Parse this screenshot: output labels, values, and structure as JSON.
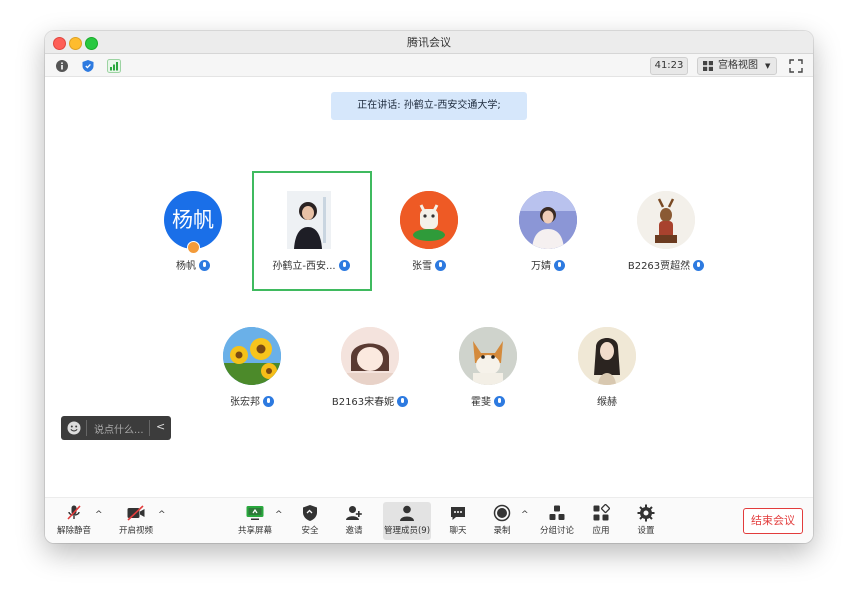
{
  "window": {
    "title": "腾讯会议"
  },
  "toolbar_top": {
    "info_icon": "info-icon",
    "security_icon": "shield-icon",
    "signal_icon": "signal-bars-icon",
    "timer": "41:23",
    "view_label": "宫格视图",
    "fullscreen_icon": "fullscreen-icon"
  },
  "speaker_banner": "正在讲话: 孙鹤立-西安交通大学;",
  "participants": [
    {
      "name": "杨帆",
      "avatar_text": "杨帆",
      "avatar_color": "#1a6fe8"
    },
    {
      "name": "孙鹤立-西安...",
      "active": true
    },
    {
      "name": "张雪"
    },
    {
      "name": "万婧"
    },
    {
      "name": "B2263贾超然"
    },
    {
      "name": "张宏邦"
    },
    {
      "name": "B2163宋春妮"
    },
    {
      "name": "霍斐"
    },
    {
      "name": "缑赫"
    }
  ],
  "chat": {
    "placeholder": "说点什么..."
  },
  "bottom_toolbar": {
    "unmute": "解除静音",
    "start_video": "开启视频",
    "share_screen": "共享屏幕",
    "security": "安全",
    "invite": "邀请",
    "manage_members": "管理成员(9)",
    "chat": "聊天",
    "record": "录制",
    "breakout": "分组讨论",
    "apps": "应用",
    "settings": "设置",
    "end_meeting": "结束会议"
  },
  "colors": {
    "accent": "#2d7ae0",
    "active_border": "#3fba5f",
    "end_red": "#e23c3c"
  }
}
